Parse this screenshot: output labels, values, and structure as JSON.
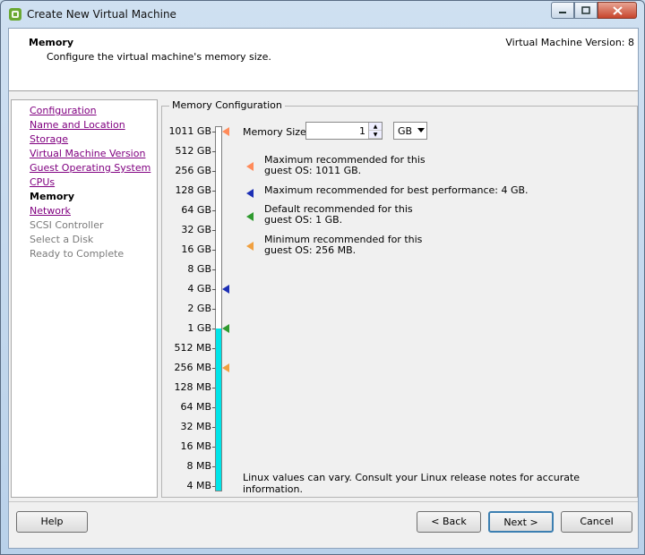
{
  "window": {
    "title": "Create New Virtual Machine"
  },
  "header": {
    "title": "Memory",
    "subtitle": "Configure the virtual machine's memory size.",
    "version": "Virtual Machine Version: 8"
  },
  "steps": [
    {
      "label": "Configuration",
      "state": "link"
    },
    {
      "label": "Name and Location",
      "state": "link"
    },
    {
      "label": "Storage",
      "state": "link"
    },
    {
      "label": "Virtual Machine Version",
      "state": "link"
    },
    {
      "label": "Guest Operating System",
      "state": "link"
    },
    {
      "label": "CPUs",
      "state": "link"
    },
    {
      "label": "Memory",
      "state": "current"
    },
    {
      "label": "Network",
      "state": "link"
    },
    {
      "label": "SCSI Controller",
      "state": "disabled"
    },
    {
      "label": "Select a Disk",
      "state": "disabled"
    },
    {
      "label": "Ready to Complete",
      "state": "disabled"
    }
  ],
  "memory": {
    "group_label": "Memory Configuration",
    "size_label": "Memory Size:",
    "size_value": "1",
    "unit": "GB",
    "scale": [
      "1011 GB",
      "512 GB",
      "256 GB",
      "128 GB",
      "64 GB",
      "32 GB",
      "16 GB",
      "8 GB",
      "4 GB",
      "2 GB",
      "1 GB",
      "512 MB",
      "256 MB",
      "128 MB",
      "64 MB",
      "32 MB",
      "16 MB",
      "8 MB",
      "4 MB"
    ],
    "fill_from_level": "1 GB",
    "markers": [
      {
        "level": "1011 GB",
        "color": "#ff8b5a"
      },
      {
        "level": "4 GB",
        "color": "#1c2fb5"
      },
      {
        "level": "1 GB",
        "color": "#2f9a2f"
      },
      {
        "level": "256 MB",
        "color": "#f0a040"
      }
    ],
    "legend": [
      {
        "line1": "Maximum recommended for this",
        "line2": "guest OS: 1011 GB.",
        "color": "#ff8b5a"
      },
      {
        "line1": "Maximum recommended for best performance: 4 GB.",
        "line2": "",
        "color": "#1c2fb5"
      },
      {
        "line1": "Default recommended for this",
        "line2": "guest OS: 1 GB.",
        "color": "#2f9a2f"
      },
      {
        "line1": "Minimum recommended for this",
        "line2": "guest OS: 256 MB.",
        "color": "#f0a040"
      }
    ],
    "note": "Linux values can vary. Consult your Linux release notes for accurate information."
  },
  "buttons": {
    "help": "Help",
    "back": "< Back",
    "next": "Next >",
    "cancel": "Cancel"
  }
}
